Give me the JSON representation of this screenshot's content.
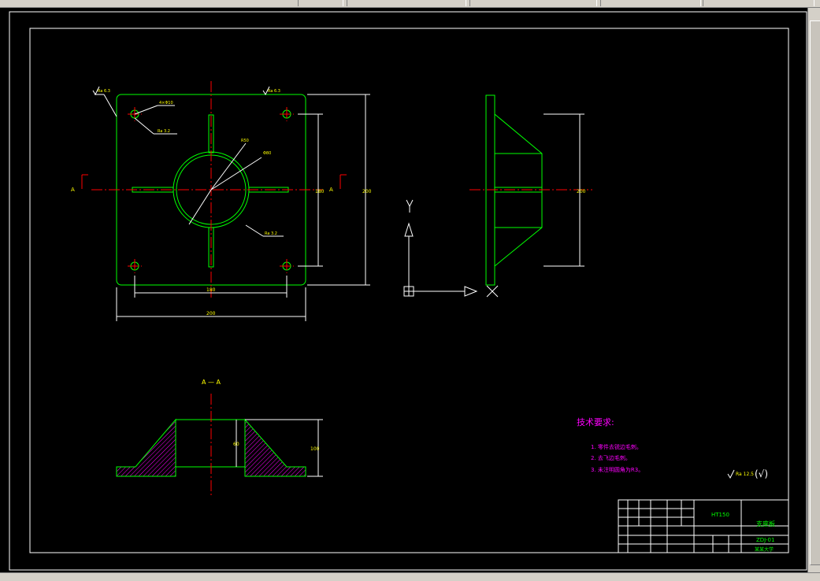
{
  "section_label": "A — A",
  "section_marker": "A",
  "tech_title": "技术要求:",
  "tech_items": [
    "1. 零件去锐边毛刺。",
    "2. 去飞边毛刺。",
    "3. 未注明圆角为R3。"
  ],
  "roughness_general": "Ra 12.5",
  "roughness_paren": "(√)",
  "roughness_tags": [
    "Ra 6.3",
    "Ra 6.3",
    "Ra 3.2",
    "Ra 3.2"
  ],
  "dimensions": {
    "inner_width": "180",
    "outer_width": "200",
    "height_inner": "180",
    "height_outer": "200",
    "side_height": "200",
    "section_height": "60",
    "section_total": "100",
    "hole_spec": "4×Φ10",
    "diameter": "Φ80",
    "radius": "R50"
  },
  "ucs": {
    "y_label": "Y"
  },
  "title_block": {
    "material": "HT150",
    "part_name": "支座板",
    "drawing_no": "ZDJ-01",
    "school": "某某大学"
  },
  "colors": {
    "frame": "#ffffff",
    "part": "#00ff00",
    "center": "#ff0000",
    "dim": "#ffffff",
    "hatch": "#ff00ff",
    "note": "#ff00ff"
  }
}
